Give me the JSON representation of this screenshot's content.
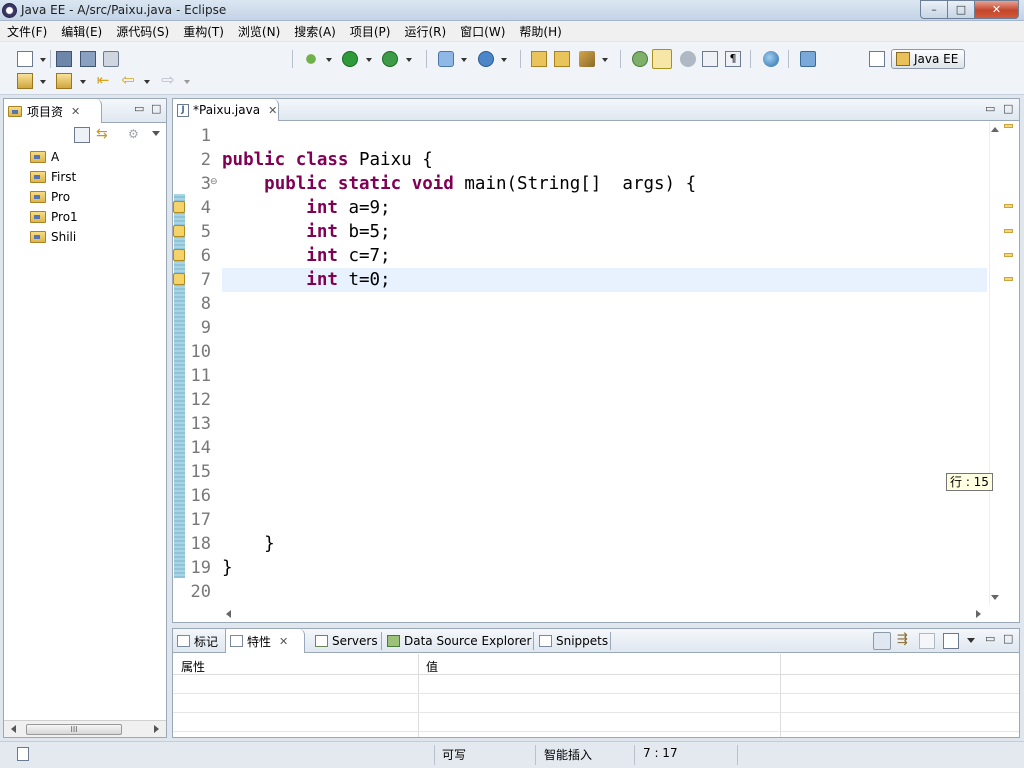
{
  "window": {
    "title": "Java EE  -  A/src/Paixu.java  -  Eclipse",
    "controls": {
      "minimize": "–",
      "maximize": "□",
      "close": "✕"
    }
  },
  "menu": [
    "文件(F)",
    "编辑(E)",
    "源代码(S)",
    "重构(T)",
    "浏览(N)",
    "搜索(A)",
    "项目(P)",
    "运行(R)",
    "窗口(W)",
    "帮助(H)"
  ],
  "perspective": {
    "label": "Java EE"
  },
  "explorer": {
    "tab_label": "项目资",
    "close": "✕",
    "projects": [
      "A",
      "First",
      "Pro",
      "Pro1",
      "Shili"
    ],
    "scroll_grip": "III"
  },
  "editor": {
    "tab_label": "*Paixu.java",
    "close": "✕",
    "line_numbers": [
      "1",
      "2",
      "3",
      "4",
      "5",
      "6",
      "7",
      "8",
      "9",
      "10",
      "11",
      "12",
      "13",
      "14",
      "15",
      "16",
      "17",
      "18",
      "19",
      "20"
    ],
    "code": {
      "l2": {
        "kw1": "public",
        "kw2": "class",
        "rest": " Paixu {"
      },
      "l3": {
        "indent": "    ",
        "kw1": "public",
        "kw2": "static",
        "kw3": "void",
        "rest": " main(String[]  args) {"
      },
      "l4": {
        "indent": "        ",
        "kw": "int",
        "rest": " a=9;"
      },
      "l5": {
        "indent": "        ",
        "kw": "int",
        "rest": " b=5;"
      },
      "l6": {
        "indent": "        ",
        "kw": "int",
        "rest": " c=7;"
      },
      "l7": {
        "indent": "        ",
        "kw": "int",
        "rest": " t=0;"
      },
      "l18": "    }",
      "l19": "}"
    },
    "fold_glyph": "⊖",
    "tooltip": "行 : 15"
  },
  "bottom_panel": {
    "tabs": [
      "标记",
      "特性",
      "Servers",
      "Data Source Explorer",
      "Snippets"
    ],
    "active_tab": "特性",
    "close": "✕",
    "columns": [
      "属性",
      "值"
    ]
  },
  "status": {
    "writable": "可写",
    "insert_mode": "智能插入",
    "position": "7 : 17"
  }
}
